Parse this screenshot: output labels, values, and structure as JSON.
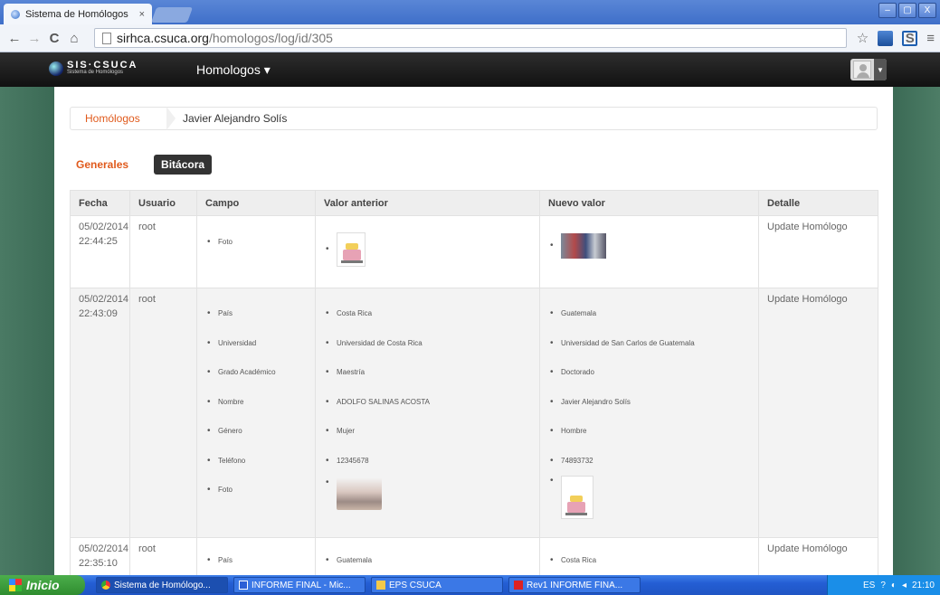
{
  "browser": {
    "tab_title": "Sistema de Homólogos",
    "tab_close": "×",
    "url_domain": "sirhca.csuca.org",
    "url_path": "/homologos/log/id/305",
    "back": "←",
    "forward": "→",
    "reload": "C",
    "home": "⌂",
    "star": "☆",
    "menu": "≡",
    "ext2_label": "S",
    "minimize": "–",
    "maximize": "▢",
    "close": "X"
  },
  "site": {
    "brand_name": "SIS·CSUCA",
    "brand_sub": "Sistema de Homólogos",
    "menu_label": "Homologos ▾"
  },
  "breadcrumb": {
    "parent": "Homólogos",
    "current": "Javier Alejandro Solís"
  },
  "tabs": {
    "generales": "Generales",
    "bitacora": "Bitácora"
  },
  "table": {
    "headers": [
      "Fecha",
      "Usuario",
      "Campo",
      "Valor anterior",
      "Nuevo valor",
      "Detalle"
    ],
    "rows": [
      {
        "date": "05/02/2014",
        "time": "22:44:25",
        "user": "root",
        "fields": [
          "Foto"
        ],
        "old": [],
        "new": [],
        "detail": "Update Homólogo"
      },
      {
        "date": "05/02/2014",
        "time": "22:43:09",
        "user": "root",
        "fields": [
          "País",
          "Universidad",
          "Grado Académico",
          "Nombre",
          "Género",
          "Teléfono",
          "Foto"
        ],
        "old": [
          "Costa Rica",
          "Universidad de Costa Rica",
          "Maestría",
          "ADOLFO SALINAS ACOSTA",
          "Mujer",
          "12345678"
        ],
        "new": [
          "Guatemala",
          "Universidad de San Carlos de Guatemala",
          "Doctorado",
          "Javier Alejandro Solís",
          "Hombre",
          "74893732"
        ],
        "detail": "Update Homólogo"
      },
      {
        "date": "05/02/2014",
        "time": "22:35:10",
        "user": "root",
        "fields": [
          "País"
        ],
        "old": [
          "Guatemala"
        ],
        "new": [
          "Costa Rica"
        ],
        "detail": "Update Homólogo"
      }
    ]
  },
  "taskbar": {
    "start": "Inicio",
    "items": [
      "Sistema de Homólogo...",
      "INFORME FINAL - Mic...",
      "EPS CSUCA",
      "Rev1 INFORME FINA..."
    ],
    "lang": "ES",
    "clock": "21:10"
  }
}
